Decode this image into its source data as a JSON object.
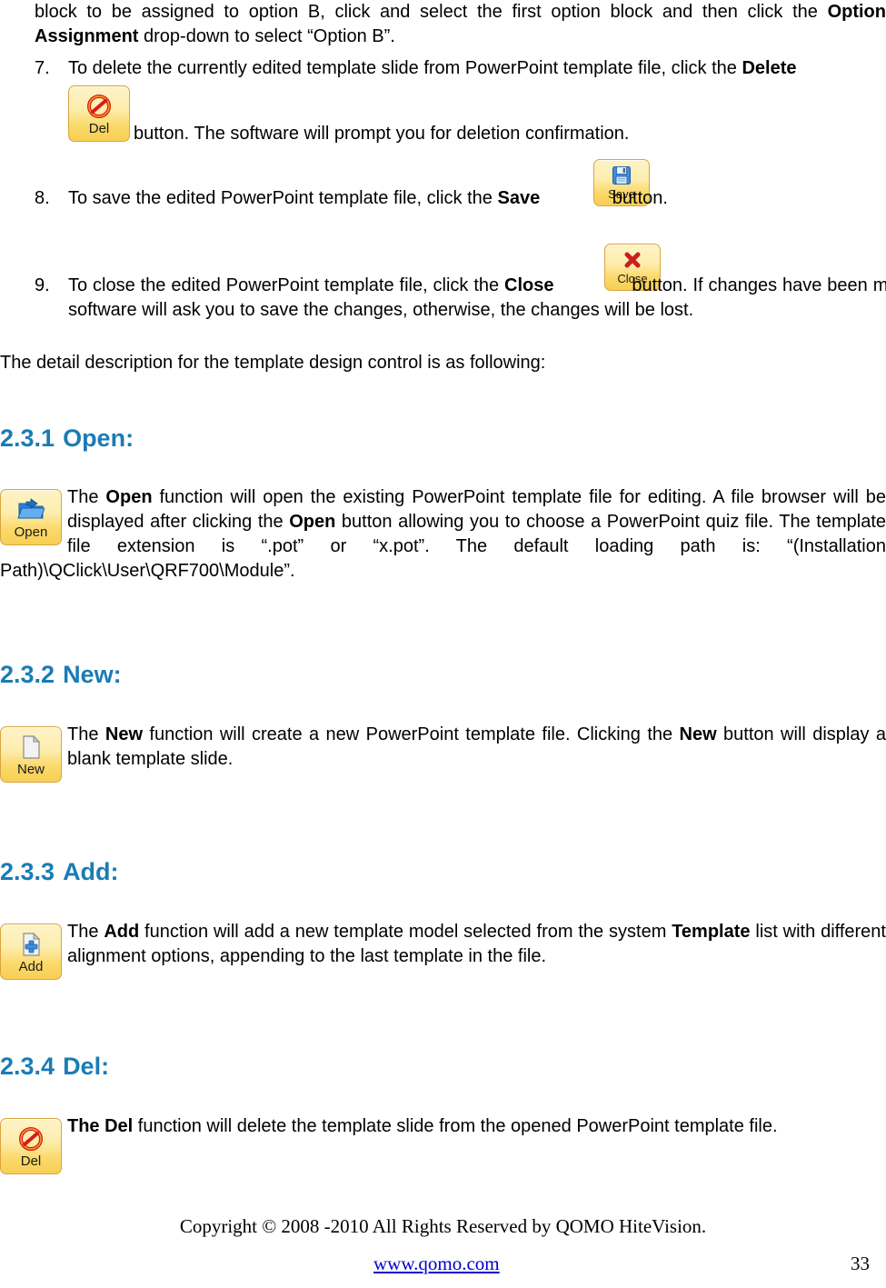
{
  "document": {
    "page_number": "33",
    "heading_color": "#1a7cb5",
    "link_color": "#0000cd"
  },
  "top_paragraph": {
    "line1": "block to be assigned to option B, click and select the first option block and then click the",
    "bold_term": "Option Assignment",
    "line2_rest": " drop-down to select “Option B”."
  },
  "list": [
    {
      "number": "7.",
      "text_before": "To delete the currently edited template slide from PowerPoint template file, click the ",
      "bold_term": "Delete",
      "text_after": "button. The software will prompt you for deletion confirmation.",
      "button": {
        "caption": "Del",
        "icon": "no-entry-icon"
      }
    },
    {
      "number": "8.",
      "text_before": "To save the edited PowerPoint template file, click the ",
      "bold_term": "Save",
      "text_after": " button.",
      "button": {
        "caption": "Save",
        "icon": "floppy-disk-icon"
      }
    },
    {
      "number": "9.",
      "text_before": "To close the edited PowerPoint template file, click the ",
      "bold_term": "Close",
      "text_after": " button. If changes have been made, the software will ask you to save the changes, otherwise, the changes will be lost.",
      "button": {
        "caption": "Close",
        "icon": "red-x-icon"
      }
    }
  ],
  "intro_paragraph": "The detail description for the template design control is as following:",
  "sections": [
    {
      "number": "2.3.1",
      "title": "Open:",
      "button": {
        "caption": "Open",
        "icon": "open-folder-icon"
      },
      "body_segments": [
        {
          "type": "text",
          "value": "The "
        },
        {
          "type": "bold",
          "value": "Open"
        },
        {
          "type": "text",
          "value": " function will open the existing PowerPoint template file for editing. A file browser will be displayed after clicking the "
        },
        {
          "type": "bold",
          "value": "Open"
        },
        {
          "type": "text",
          "value": " button allowing you to choose a PowerPoint quiz file. The template file extension is “.pot” or “x.pot”. The default loading path is: “(Installation Path)\\QClick\\User\\QRF700\\Module”."
        }
      ]
    },
    {
      "number": "2.3.2",
      "title": "New:",
      "button": {
        "caption": "New",
        "icon": "blank-page-icon"
      },
      "body_segments": [
        {
          "type": "text",
          "value": "The "
        },
        {
          "type": "bold",
          "value": "New"
        },
        {
          "type": "text",
          "value": " function will create a new PowerPoint template file. Clicking the "
        },
        {
          "type": "bold",
          "value": "New"
        },
        {
          "type": "text",
          "value": " button will display a blank template slide."
        }
      ]
    },
    {
      "number": "2.3.3",
      "title": "Add:",
      "button": {
        "caption": "Add",
        "icon": "page-plus-icon"
      },
      "body_segments": [
        {
          "type": "text",
          "value": "The "
        },
        {
          "type": "bold",
          "value": "Add"
        },
        {
          "type": "text",
          "value": " function will add a new template model selected from the system "
        },
        {
          "type": "bold",
          "value": "Template"
        },
        {
          "type": "text",
          "value": " list with different alignment options, appending to the last template in the file."
        }
      ]
    },
    {
      "number": "2.3.4",
      "title": "Del:",
      "button": {
        "caption": "Del",
        "icon": "no-entry-icon"
      },
      "body_segments": [
        {
          "type": "bold",
          "value": "The Del"
        },
        {
          "type": "text",
          "value": " function will delete the template slide from the opened PowerPoint template file."
        }
      ]
    }
  ],
  "footer": {
    "copyright": "Copyright © 2008 -2010 All Rights Reserved by QOMO HiteVision.",
    "website": "www.qomo.com",
    "page": "33"
  }
}
